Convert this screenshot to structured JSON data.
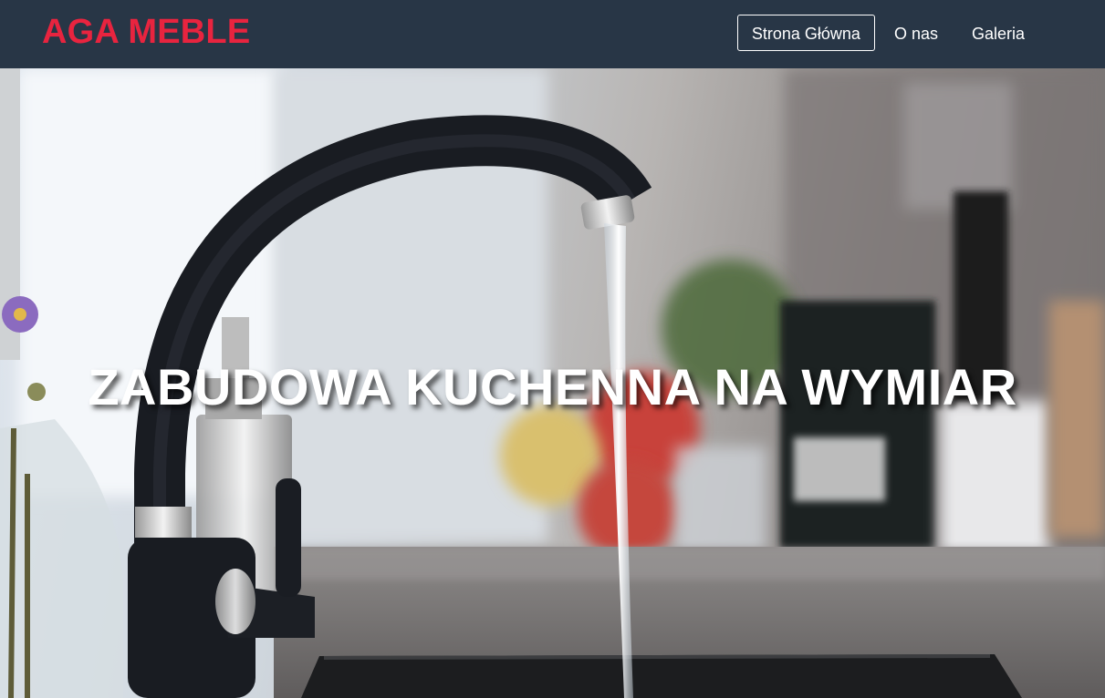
{
  "header": {
    "brand": "AGA MEBLE",
    "nav": [
      {
        "label": "Strona Główna",
        "active": true
      },
      {
        "label": "O nas",
        "active": false
      },
      {
        "label": "Galeria",
        "active": false
      }
    ]
  },
  "hero": {
    "title": "ZABUDOWA KUCHENNA NA WYMIAR",
    "image": "kitchen-faucet-photo"
  },
  "colors": {
    "navbar_bg": "#283646",
    "brand": "#e8243f",
    "nav_text": "#ffffff"
  }
}
